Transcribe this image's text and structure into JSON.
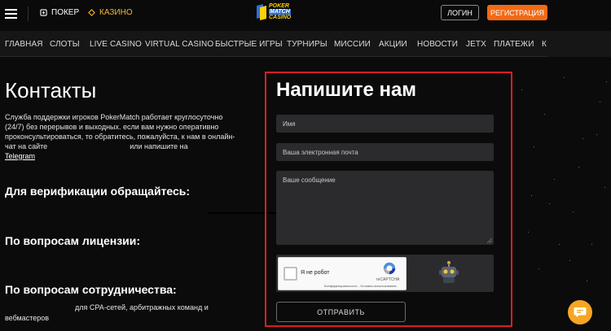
{
  "header": {
    "menu_icon": "hamburger-icon",
    "poker_label": "ПОКЕР",
    "casino_label": "КАЗИНО",
    "logo": {
      "line1": "POKER",
      "line2": "MATCH",
      "line3": "CASINO"
    },
    "login_label": "ЛОГИН",
    "register_label": "РЕГИСТРАЦИЯ",
    "accent_color": "#f26a16"
  },
  "nav": {
    "items": [
      {
        "label": "ГЛАВНАЯ"
      },
      {
        "label": "СЛОТЫ"
      },
      {
        "label": "LIVE CASINO"
      },
      {
        "label": "VIRTUAL CASINO"
      },
      {
        "label": "БЫСТРЫЕ ИГРЫ"
      },
      {
        "label": "ТУРНИРЫ"
      },
      {
        "label": "МИССИИ"
      },
      {
        "label": "АКЦИИ"
      },
      {
        "label": "НОВОСТИ"
      },
      {
        "label": "JETX"
      },
      {
        "label": "ПЛАТЕЖИ"
      },
      {
        "label": "К"
      }
    ]
  },
  "contacts": {
    "title": "Контакты",
    "description": "Служба поддержки игроков PokerMatch работает круглосуточно (24/7) без перерывов и выходных. если вам нужно оперативно проконсультироваться, то обратитесь, пожалуйста, к нам в онлайн-чат на сайте",
    "description_tail": "или напишите на",
    "telegram_link": "Telegram",
    "verification_heading": "Для верификации обращайтесь:",
    "license_heading": "По вопросам лицензии:",
    "cooperation_heading": "По вопросам сотрудничества:",
    "cooperation_text": "для CPA-сетей, арбитражных команд и вебмастеров"
  },
  "form": {
    "title": "Напишите нам",
    "name_placeholder": "Имя",
    "email_placeholder": "Ваша электронная почта",
    "message_placeholder": "Ваше сообщение",
    "captcha_label": "Я не робот",
    "captcha_brand": "reCAPTCHA",
    "captcha_links": "Конфиденциальность - Условия использования",
    "submit_label": "ОТПРАВИТЬ",
    "border_color": "#d81e25"
  },
  "chat": {
    "icon": "chat-bubble-icon",
    "color": "#f5a623"
  }
}
